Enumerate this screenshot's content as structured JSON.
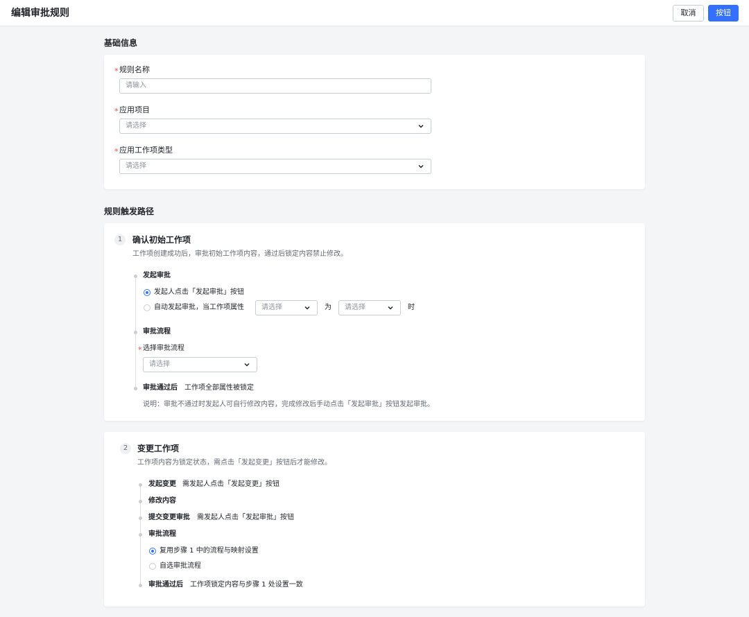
{
  "header": {
    "title": "编辑审批规则",
    "cancel_label": "取消",
    "primary_label": "按钮"
  },
  "basic": {
    "title": "基础信息",
    "name_label": "规则名称",
    "name_placeholder": "请输入",
    "project_label": "应用项目",
    "project_placeholder": "请选择",
    "type_label": "应用工作项类型",
    "type_placeholder": "请选择"
  },
  "trigger": {
    "title": "规则触发路径"
  },
  "step1": {
    "num": "1",
    "title": "确认初始工作项",
    "desc": "工作项创建成功后，审批初始工作项内容，通过后锁定内容禁止修改。",
    "start_title": "发起审批",
    "option_manual": "发起人点击「发起审批」按钮",
    "option_auto": "自动发起审批，当工作项属性",
    "attr_placeholder": "请选择",
    "is_text": "为",
    "value_placeholder": "请选择",
    "when_text": "时",
    "flow_title": "审批流程",
    "flow_select_label": "选择审批流程",
    "flow_placeholder": "请选择",
    "after_title": "审批通过后",
    "after_text": "工作项全部属性被锁定",
    "note": "说明：审批不通过时发起人可自行修改内容，完成修改后手动点击「发起审批」按钮发起审批。"
  },
  "step2": {
    "num": "2",
    "title": "变更工作项",
    "desc": "工作项内容为锁定状态，需点击「发起变更」按钮后才能修改。",
    "change_title": "发起变更",
    "change_text": "需发起人点击「发起变更」按钮",
    "modify_title": "修改内容",
    "submit_title": "提交变更审批",
    "submit_text": "需发起人点击「发起审批」按钮",
    "flow_title": "审批流程",
    "option_reuse": "复用步骤 1 中的流程与映射设置",
    "option_custom": "自选审批流程",
    "after_title": "审批通过后",
    "after_text": "工作项锁定内容与步骤 1 处设置一致"
  },
  "icons": {
    "chevron": "chevron-down-icon"
  },
  "colors": {
    "primary": "#3370ff",
    "required": "#f54a45",
    "border": "#c9cdd4"
  }
}
